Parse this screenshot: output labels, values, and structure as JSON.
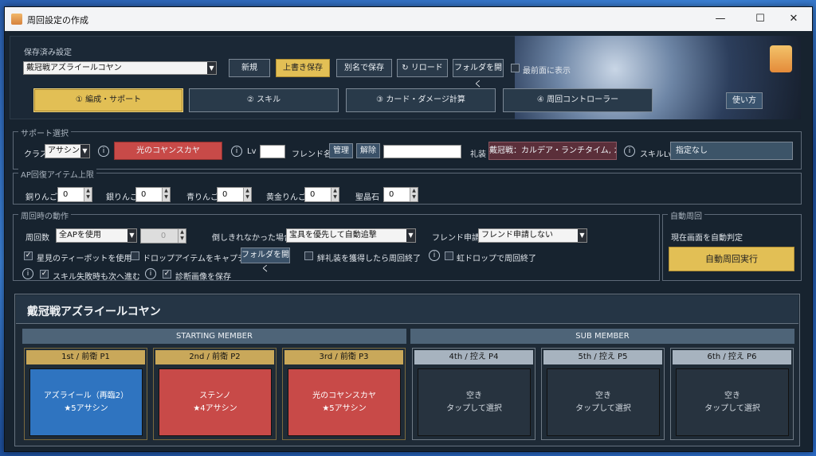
{
  "window": {
    "title": "周回設定の作成",
    "minimize": "—",
    "maximize": "☐",
    "close": "✕"
  },
  "saved": {
    "label": "保存済み設定",
    "selected": "戴冠戦アズライールコヤン",
    "buttons": {
      "new": "新規",
      "overwrite": "上書き保存",
      "save_as": "別名で保存",
      "reload": "リロード",
      "open_folder": "フォルダを開く"
    },
    "topmost_label": "最前面に表示",
    "reload_icon": "↻"
  },
  "tabs": [
    "① 編成・サポート",
    "② スキル",
    "③ カード・ダメージ計算",
    "④ 周回コントローラー"
  ],
  "howto": "使い方",
  "support": {
    "group_label": "サポート選択",
    "class_label": "クラス",
    "class_value": "アサシン",
    "servant": "光のコヤンスカヤ",
    "lv_label": "Lv",
    "lv_value": "",
    "friend_label": "フレンド名",
    "manage": "管理",
    "release": "解除",
    "friend_value": "",
    "ce_label": "礼装",
    "ce_value": "戴冠戦：カルデア・ランチタイム, カルテ",
    "skill_label": "スキルLv",
    "skill_value": "指定なし"
  },
  "ap": {
    "group_label": "AP回復アイテム上限",
    "items": [
      {
        "label": "銅りんご",
        "value": "0"
      },
      {
        "label": "銀りんご",
        "value": "0"
      },
      {
        "label": "青りんご",
        "value": "0"
      },
      {
        "label": "黄金りんご",
        "value": "0"
      },
      {
        "label": "聖晶石",
        "value": "0"
      }
    ]
  },
  "loop": {
    "group_label": "周回時の動作",
    "count_label": "周回数",
    "count_value": "全APを使用",
    "count_num": "0",
    "fail_label": "倒しきれなかった場合",
    "fail_value": "宝具を優先して自動追撃",
    "friend_req_label": "フレンド申請",
    "friend_req_value": "フレンド申請しない",
    "chk1": "星見のティーポットを使用",
    "chk2": "ドロップアイテムをキャプチャする",
    "folder_btn": "フォルダを開く",
    "chk3": "絆礼装を獲得したら周回終了",
    "chk4": "虹ドロップで周回終了",
    "chk5": "スキル失敗時も次へ進む",
    "chk6": "診断画像を保存",
    "check": "✓"
  },
  "auto": {
    "group_label": "自動周回",
    "desc": "現在画面を自動判定",
    "run": "自動周回実行"
  },
  "party": {
    "title": "戴冠戦アズライールコヤン",
    "starting": "STARTING MEMBER",
    "sub": "SUB MEMBER",
    "slots": [
      {
        "head": "1st / 前衛 P1",
        "line1": "アズライール（再臨2）",
        "line2": "★5アサシン"
      },
      {
        "head": "2nd / 前衛 P2",
        "line1": "ステンノ",
        "line2": "★4アサシン"
      },
      {
        "head": "3rd / 前衛 P3",
        "line1": "光のコヤンスカヤ",
        "line2": "★5アサシン"
      },
      {
        "head": "4th / 控え P4",
        "line1": "空き",
        "line2": "タップして選択"
      },
      {
        "head": "5th / 控え P5",
        "line1": "空き",
        "line2": "タップして選択"
      },
      {
        "head": "6th / 控え P6",
        "line1": "空き",
        "line2": "タップして選択"
      }
    ]
  },
  "colors": {
    "gold": "#e2bf55",
    "servant_blue": "#2f74c0",
    "servant_red": "#c84a48",
    "empty": "#27333f"
  }
}
